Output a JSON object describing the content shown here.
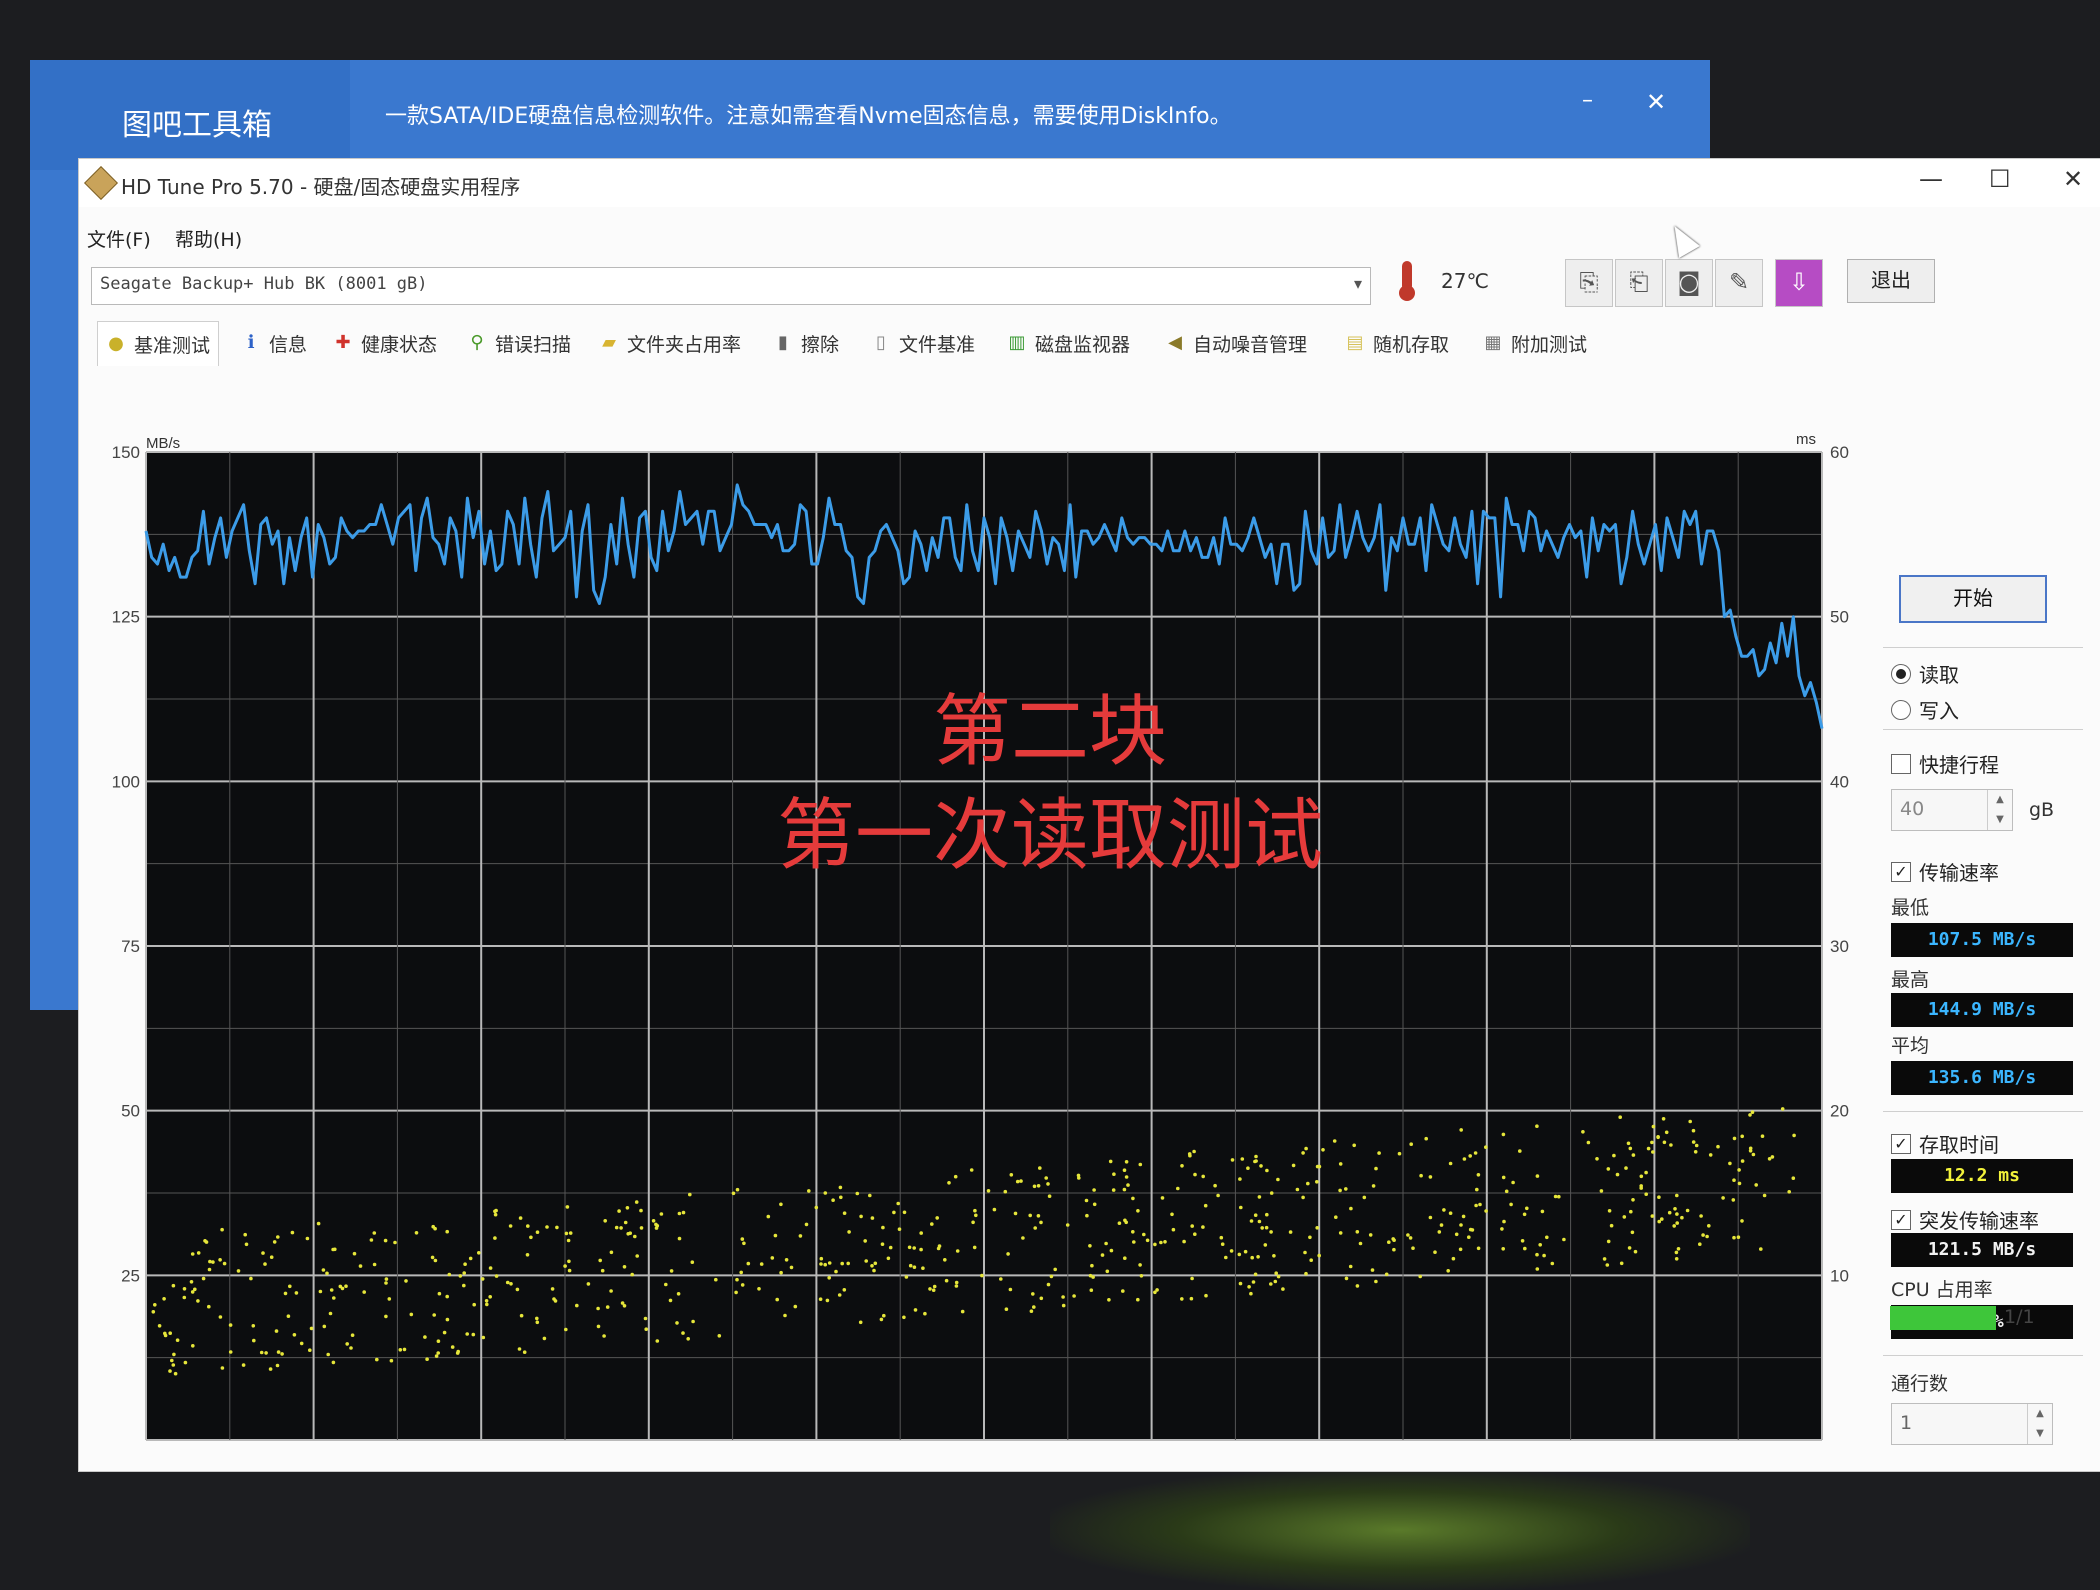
{
  "background_window": {
    "title": "图吧工具箱",
    "description": "一款SATA/IDE硬盘信息检测软件。注意如需查看Nvme固态信息，需要使用DiskInfo。",
    "min_icon": "minimize-icon",
    "close_icon": "close-icon"
  },
  "window": {
    "title": "HD Tune Pro 5.70 - 硬盘/固态硬盘实用程序",
    "menu": [
      "文件(F)",
      "帮助(H)"
    ],
    "drive": "Seagate Backup+ Hub BK (8001 gB)",
    "temperature": "27℃",
    "quit_label": "退出",
    "toolbar_icons": [
      "copy-icon",
      "paste-icon",
      "camera-icon",
      "settings-icon",
      "download-icon"
    ]
  },
  "tabs": [
    {
      "label": "基准测试",
      "icon": "bulb-icon",
      "active": true
    },
    {
      "label": "信息",
      "icon": "info-icon"
    },
    {
      "label": "健康状态",
      "icon": "health-cross-icon"
    },
    {
      "label": "错误扫描",
      "icon": "magnifier-icon"
    },
    {
      "label": "文件夹占用率",
      "icon": "folder-icon"
    },
    {
      "label": "擦除",
      "icon": "trash-icon"
    },
    {
      "label": "文件基准",
      "icon": "file-icon"
    },
    {
      "label": "磁盘监视器",
      "icon": "monitor-chart-icon"
    },
    {
      "label": "自动噪音管理",
      "icon": "speaker-icon"
    },
    {
      "label": "随机存取",
      "icon": "random-access-icon"
    },
    {
      "label": "附加测试",
      "icon": "extra-test-icon"
    }
  ],
  "chart_data": {
    "type": "line",
    "left_unit": "MB/s",
    "right_unit": "ms",
    "left_ticks": [
      150,
      125,
      100,
      75,
      50,
      25
    ],
    "right_ticks": [
      60,
      50,
      40,
      30,
      20,
      10
    ],
    "ylim_left": [
      0,
      150
    ],
    "ylim_right": [
      0,
      60
    ],
    "grid": true,
    "line_color": "#3c9ce8",
    "dot_color": "#e6e63a",
    "series": [
      {
        "values": [
          138,
          134,
          133,
          136,
          132,
          134,
          131,
          131,
          134,
          135,
          141,
          133,
          137,
          140,
          134,
          138,
          140,
          142,
          135,
          130,
          139,
          140,
          136,
          138,
          130,
          137,
          132,
          137,
          140,
          131,
          139,
          137,
          133,
          134,
          140,
          138,
          137,
          138,
          138,
          139,
          139,
          142,
          139,
          136,
          140,
          141,
          142,
          132,
          140,
          143,
          137,
          136,
          133,
          140,
          138,
          131,
          143,
          137,
          141,
          133,
          138,
          132,
          133,
          141,
          139,
          133,
          143,
          136,
          131,
          140,
          144,
          135,
          136,
          137,
          141,
          128,
          138,
          142,
          129,
          127,
          131,
          139,
          133,
          143,
          136,
          131,
          140,
          141,
          134,
          132,
          141,
          135,
          138,
          144,
          139,
          140,
          141,
          136,
          141,
          141,
          135,
          137,
          139,
          145,
          142,
          141,
          139,
          139,
          139,
          137,
          139,
          135,
          135,
          136,
          142,
          141,
          133,
          133,
          137,
          143,
          139,
          139,
          135,
          134,
          128,
          127,
          134,
          135,
          138,
          139,
          137,
          135,
          130,
          131,
          138,
          136,
          132,
          137,
          134,
          140,
          140,
          134,
          132,
          142,
          135,
          132,
          140,
          137,
          130,
          140,
          137,
          132,
          138,
          136,
          134,
          141,
          138,
          133,
          137,
          136,
          132,
          142,
          131,
          138,
          138,
          136,
          137,
          139,
          137,
          135,
          140,
          137,
          136,
          137,
          137,
          136,
          136,
          135,
          138,
          135,
          135,
          138,
          135,
          137,
          134,
          134,
          137,
          133,
          140,
          136,
          136,
          135,
          137,
          140,
          137,
          134,
          136,
          130,
          136,
          136,
          129,
          130,
          141,
          135,
          133,
          140,
          134,
          135,
          142,
          134,
          137,
          141,
          137,
          135,
          137,
          142,
          129,
          137,
          135,
          140,
          136,
          136,
          140,
          132,
          142,
          139,
          136,
          135,
          140,
          136,
          134,
          141,
          130,
          141,
          140,
          140,
          128,
          143,
          139,
          139,
          135,
          141,
          140,
          135,
          138,
          136,
          134,
          137,
          139,
          137,
          138,
          131,
          140,
          135,
          139,
          138,
          139,
          130,
          134,
          141,
          136,
          133,
          136,
          139,
          132,
          140,
          137,
          134,
          141,
          139,
          141,
          133,
          138,
          138,
          135,
          125,
          126,
          122,
          119,
          119,
          120,
          116,
          117,
          121,
          118,
          124,
          119,
          125,
          116,
          113,
          115,
          112,
          108
        ]
      }
    ],
    "readings": {
      "min": "107.5 MB/s",
      "max": "144.9 MB/s",
      "avg": "135.6 MB/s",
      "access_time": "12.2 ms",
      "burst_rate": "121.5 MB/s",
      "cpu_usage": "9.1%"
    }
  },
  "overlay": {
    "line1": "第二块",
    "line2": "第一次读取测试",
    "color": "#e53b3b"
  },
  "panel": {
    "start": "开始",
    "read": "读取",
    "write": "写入",
    "quick": "快捷行程",
    "quick_value": "40",
    "quick_unit": "gB",
    "transfer_rate": "传输速率",
    "min_label": "最低",
    "max_label": "最高",
    "avg_label": "平均",
    "access_time_label": "存取时间",
    "burst_label": "突发传输速率",
    "cpu_label": "CPU 占用率",
    "passes_label": "通行数",
    "passes_value": "1",
    "progress_text": "1/1",
    "progress": 1.0
  }
}
